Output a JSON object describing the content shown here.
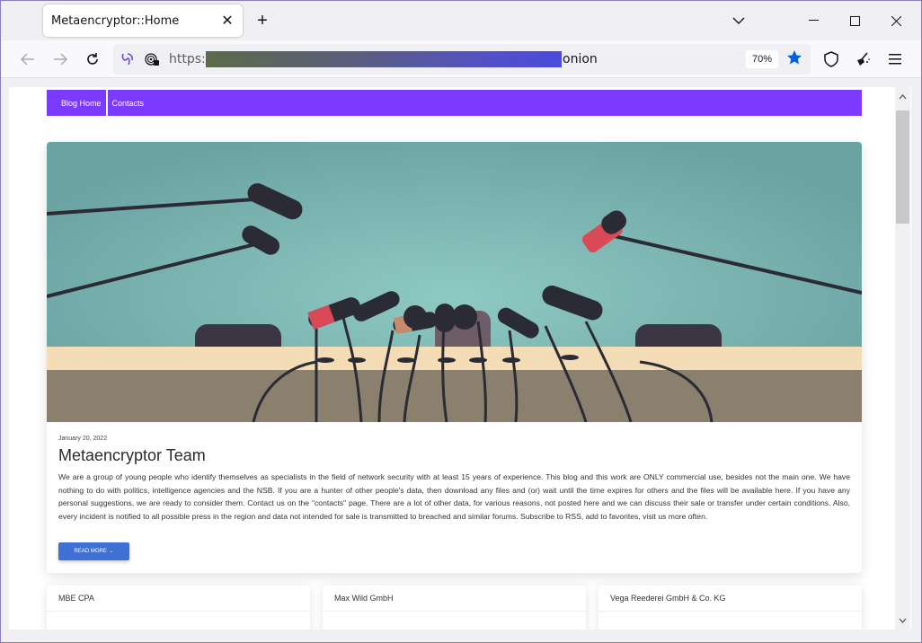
{
  "browser": {
    "tab_title": "Metaencryptor::Home",
    "tab_close_glyph": "✕",
    "new_tab_glyph": "+",
    "url_scheme": "https://",
    "url_suffix": "onion",
    "zoom": "70%",
    "bookmarked": true,
    "accent": "#0060df"
  },
  "site": {
    "nav": [
      {
        "label": "Blog Home"
      },
      {
        "label": "Contacts"
      }
    ],
    "nav_color": "#7c3aff",
    "post": {
      "date": "January 20, 2022",
      "title": "Metaencryptor Team",
      "body": "We are a group of young people who identify themselves as specialists in the field of network security with at least 15 years of experience. This blog and this work are ONLY commercial use, besides not the main one. We have nothing to do with politics, intelligence agencies and the NSB. If you are a hunter of other people's data, then download any files and (or) wait until the time expires for others and the files will be available here. If you have any personal suggestions, we are ready to consider them. Contact us on the \"contacts\" page. There are a lot of other data, for various reasons, not posted here and we can discuss their sale or transfer under certain conditions. Also, every incident is notified to all possible press in the region and data not intended for sale is transmitted to breached and similar forums. Subscribe to RSS, add to favorites, visit us more often.",
      "read_more": "READ MORE →",
      "button_color": "#3f70d4"
    },
    "cards": [
      {
        "label": "MBE CPA"
      },
      {
        "label": "Max Wild GmbH"
      },
      {
        "label": "Vega Reederei GmbH & Co. KG"
      }
    ]
  }
}
